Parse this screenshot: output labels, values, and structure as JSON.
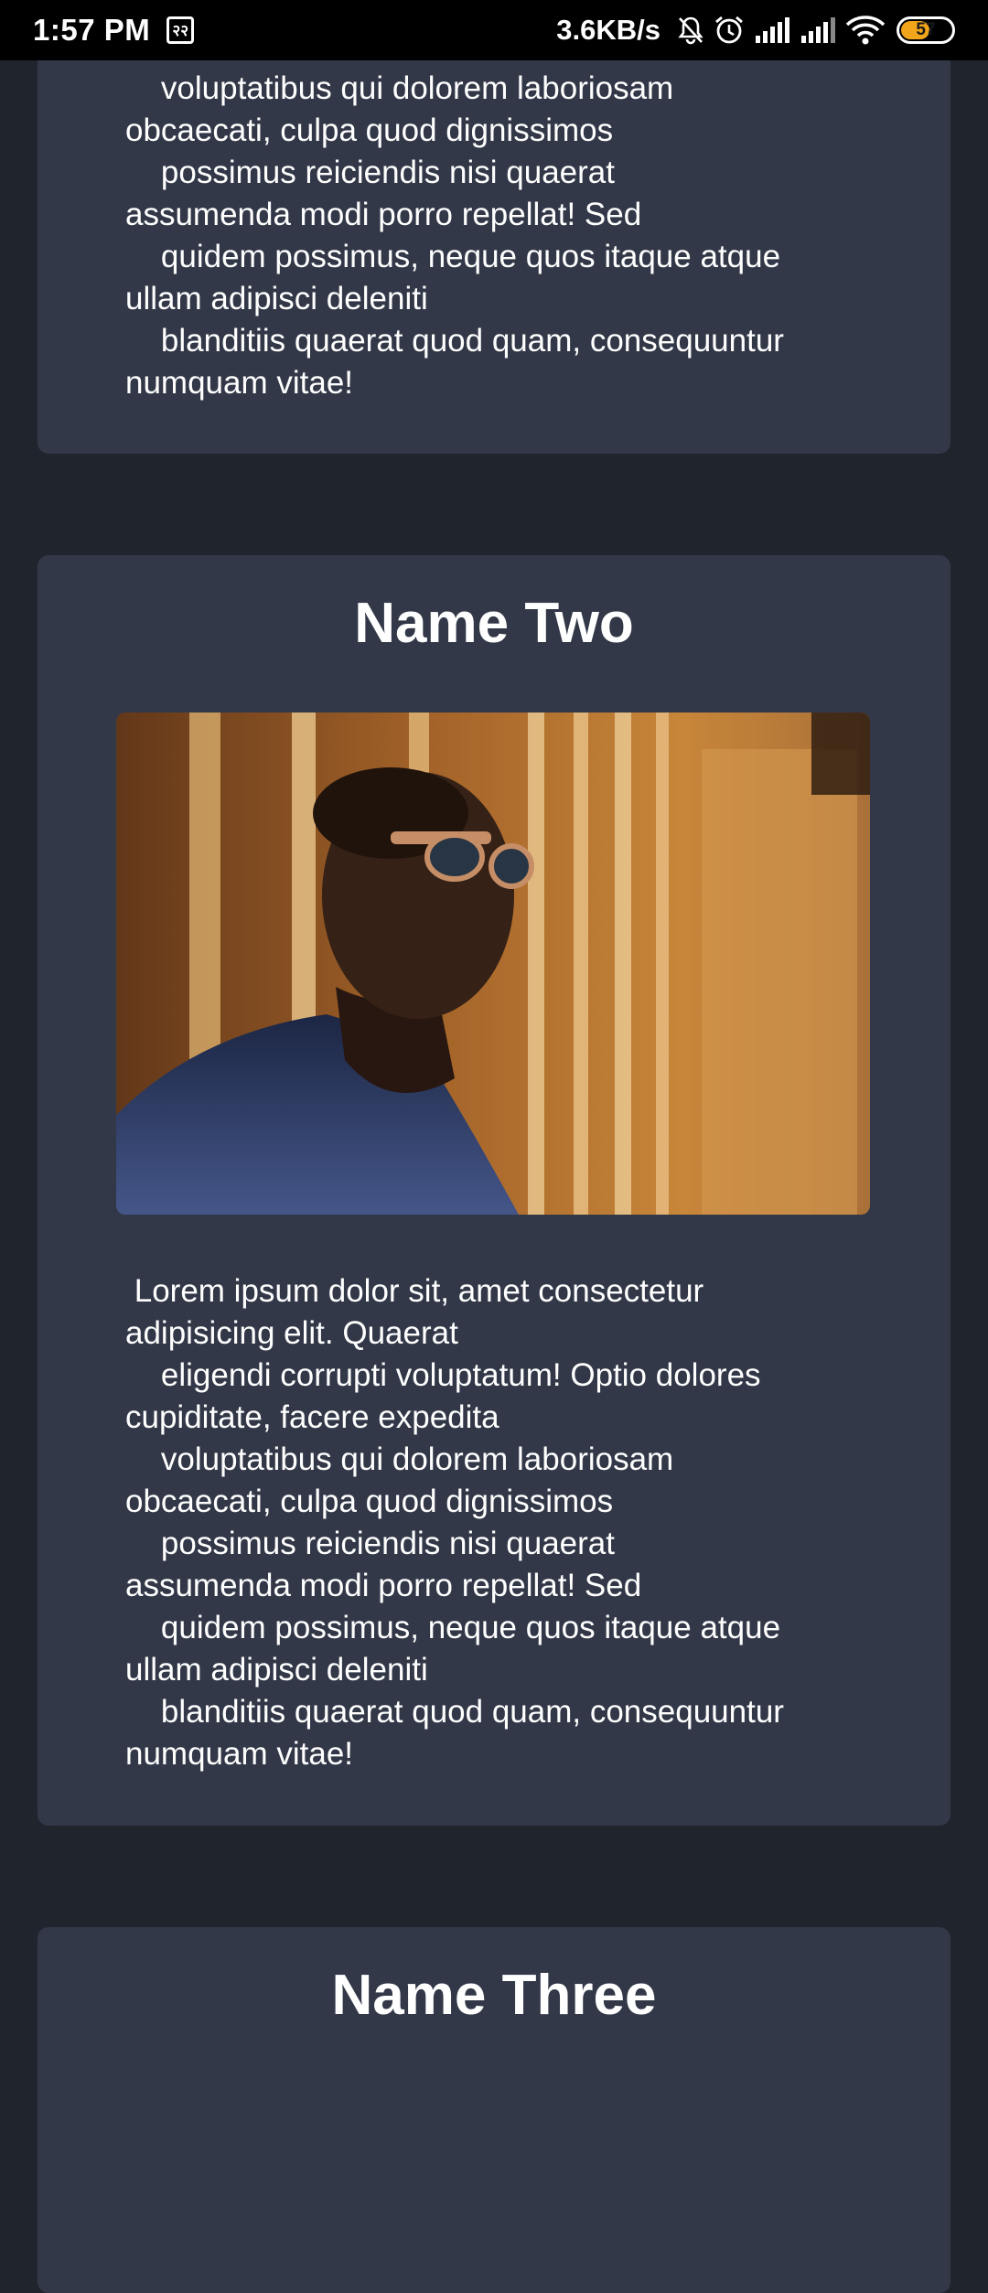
{
  "status_bar": {
    "time": "1:57 PM",
    "app_icon": "२२",
    "network_speed": "3.6KB/s",
    "battery_level": "57",
    "icons": [
      "mute-bell-icon",
      "alarm-icon",
      "signal-icon",
      "signal-icon",
      "wifi-icon",
      "battery-icon"
    ],
    "battery_color": "#f2a51a"
  },
  "card_one": {
    "description": "    voluptatibus qui dolorem laboriosam\nobcaecati, culpa quod dignissimos\n    possimus reiciendis nisi quaerat\nassumenda modi porro repellat! Sed\n    quidem possimus, neque quos itaque atque\nullam adipisci deleniti\n    blanditiis quaerat quod quam, consequuntur\nnumquam vitae!"
  },
  "card_two": {
    "name": "Name Two",
    "photo": "person-with-sunglasses-photo",
    "description": " Lorem ipsum dolor sit, amet consectetur\nadipisicing elit. Quaerat\n    eligendi corrupti voluptatum! Optio dolores\ncupiditate, facere expedita\n    voluptatibus qui dolorem laboriosam\nobcaecati, culpa quod dignissimos\n    possimus reiciendis nisi quaerat\nassumenda modi porro repellat! Sed\n    quidem possimus, neque quos itaque atque\nullam adipisci deleniti\n    blanditiis quaerat quod quam, consequuntur\nnumquam vitae!"
  },
  "card_three": {
    "name": "Name Three"
  },
  "colors": {
    "page_bg": "#20242d",
    "card_bg": "#323848",
    "text": "#ffffff"
  }
}
